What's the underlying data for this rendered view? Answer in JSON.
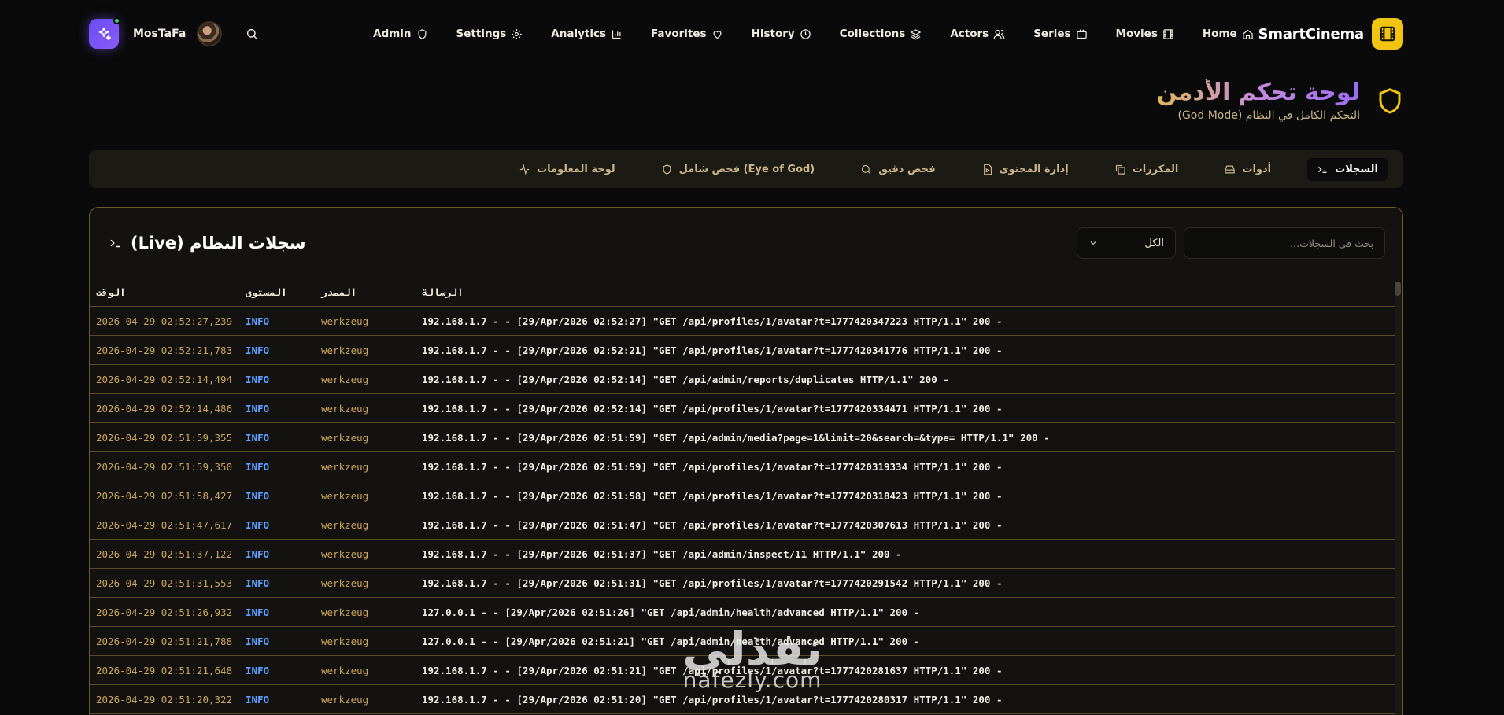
{
  "nav": {
    "username": "MosTaFa",
    "items": [
      {
        "label": "Admin",
        "icon": "shield-icon"
      },
      {
        "label": "Settings",
        "icon": "gear-icon"
      },
      {
        "label": "Analytics",
        "icon": "bar-chart-icon"
      },
      {
        "label": "Favorites",
        "icon": "heart-icon"
      },
      {
        "label": "History",
        "icon": "clock-icon"
      },
      {
        "label": "Collections",
        "icon": "layers-icon"
      },
      {
        "label": "Actors",
        "icon": "users-icon"
      },
      {
        "label": "Series",
        "icon": "tv-icon"
      },
      {
        "label": "Movies",
        "icon": "film-icon"
      },
      {
        "label": "Home",
        "icon": "home-icon"
      }
    ],
    "brand": "SmartCinema"
  },
  "header": {
    "title": "لوحة تحكم الأدمن",
    "subtitle": "التحكم الكامل في النظام (God Mode)"
  },
  "tabs": [
    {
      "label": "السجلات",
      "icon": "terminal-icon",
      "active": true
    },
    {
      "label": "أدوات",
      "icon": "hard-drive-icon",
      "active": false
    },
    {
      "label": "المكررات",
      "icon": "copy-icon",
      "active": false
    },
    {
      "label": "إدارة المحتوى",
      "icon": "file-video-icon",
      "active": false
    },
    {
      "label": "فحص دقيق",
      "icon": "search-icon",
      "active": false
    },
    {
      "label": "فحص شامل (Eye of God)",
      "icon": "shield-icon",
      "active": false
    },
    {
      "label": "لوحة المعلومات",
      "icon": "activity-icon",
      "active": false
    }
  ],
  "panel": {
    "title": "سجلات النظام (Live)",
    "search_placeholder": "بحث في السجلات...",
    "filter_value": "الكل"
  },
  "table": {
    "columns": {
      "time": "الوقت",
      "level": "المستوى",
      "source": "المصدر",
      "message": "الرسالة"
    },
    "rows": [
      {
        "time": "2026-04-29 02:52:27,239",
        "level": "INFO",
        "source": "werkzeug",
        "message": "192.168.1.7 - - [29/Apr/2026 02:52:27] \"GET /api/profiles/1/avatar?t=1777420347223 HTTP/1.1\" 200 -"
      },
      {
        "time": "2026-04-29 02:52:21,783",
        "level": "INFO",
        "source": "werkzeug",
        "message": "192.168.1.7 - - [29/Apr/2026 02:52:21] \"GET /api/profiles/1/avatar?t=1777420341776 HTTP/1.1\" 200 -"
      },
      {
        "time": "2026-04-29 02:52:14,494",
        "level": "INFO",
        "source": "werkzeug",
        "message": "192.168.1.7 - - [29/Apr/2026 02:52:14] \"GET /api/admin/reports/duplicates HTTP/1.1\" 200 -"
      },
      {
        "time": "2026-04-29 02:52:14,486",
        "level": "INFO",
        "source": "werkzeug",
        "message": "192.168.1.7 - - [29/Apr/2026 02:52:14] \"GET /api/profiles/1/avatar?t=1777420334471 HTTP/1.1\" 200 -"
      },
      {
        "time": "2026-04-29 02:51:59,355",
        "level": "INFO",
        "source": "werkzeug",
        "message": "192.168.1.7 - - [29/Apr/2026 02:51:59] \"GET /api/admin/media?page=1&limit=20&search=&type= HTTP/1.1\" 200 -"
      },
      {
        "time": "2026-04-29 02:51:59,350",
        "level": "INFO",
        "source": "werkzeug",
        "message": "192.168.1.7 - - [29/Apr/2026 02:51:59] \"GET /api/profiles/1/avatar?t=1777420319334 HTTP/1.1\" 200 -"
      },
      {
        "time": "2026-04-29 02:51:58,427",
        "level": "INFO",
        "source": "werkzeug",
        "message": "192.168.1.7 - - [29/Apr/2026 02:51:58] \"GET /api/profiles/1/avatar?t=1777420318423 HTTP/1.1\" 200 -"
      },
      {
        "time": "2026-04-29 02:51:47,617",
        "level": "INFO",
        "source": "werkzeug",
        "message": "192.168.1.7 - - [29/Apr/2026 02:51:47] \"GET /api/profiles/1/avatar?t=1777420307613 HTTP/1.1\" 200 -"
      },
      {
        "time": "2026-04-29 02:51:37,122",
        "level": "INFO",
        "source": "werkzeug",
        "message": "192.168.1.7 - - [29/Apr/2026 02:51:37] \"GET /api/admin/inspect/11 HTTP/1.1\" 200 -"
      },
      {
        "time": "2026-04-29 02:51:31,553",
        "level": "INFO",
        "source": "werkzeug",
        "message": "192.168.1.7 - - [29/Apr/2026 02:51:31] \"GET /api/profiles/1/avatar?t=1777420291542 HTTP/1.1\" 200 -"
      },
      {
        "time": "2026-04-29 02:51:26,932",
        "level": "INFO",
        "source": "werkzeug",
        "message": "127.0.0.1 - - [29/Apr/2026 02:51:26] \"GET /api/admin/health/advanced HTTP/1.1\" 200 -"
      },
      {
        "time": "2026-04-29 02:51:21,788",
        "level": "INFO",
        "source": "werkzeug",
        "message": "127.0.0.1 - - [29/Apr/2026 02:51:21] \"GET /api/admin/health/advanced HTTP/1.1\" 200 -"
      },
      {
        "time": "2026-04-29 02:51:21,648",
        "level": "INFO",
        "source": "werkzeug",
        "message": "192.168.1.7 - - [29/Apr/2026 02:51:21] \"GET /api/profiles/1/avatar?t=1777420281637 HTTP/1.1\" 200 -"
      },
      {
        "time": "2026-04-29 02:51:20,322",
        "level": "INFO",
        "source": "werkzeug",
        "message": "192.168.1.7 - - [29/Apr/2026 02:51:20] \"GET /api/profiles/1/avatar?t=1777420280317 HTTP/1.1\" 200 -"
      }
    ]
  },
  "watermark": {
    "logo": "نفذلي",
    "url": "nafezly.com"
  },
  "colors": {
    "accent": "#f1c40f",
    "panel_border": "#6b5a2c",
    "info": "#5aa0ff",
    "gold_text": "#c9a55a"
  }
}
